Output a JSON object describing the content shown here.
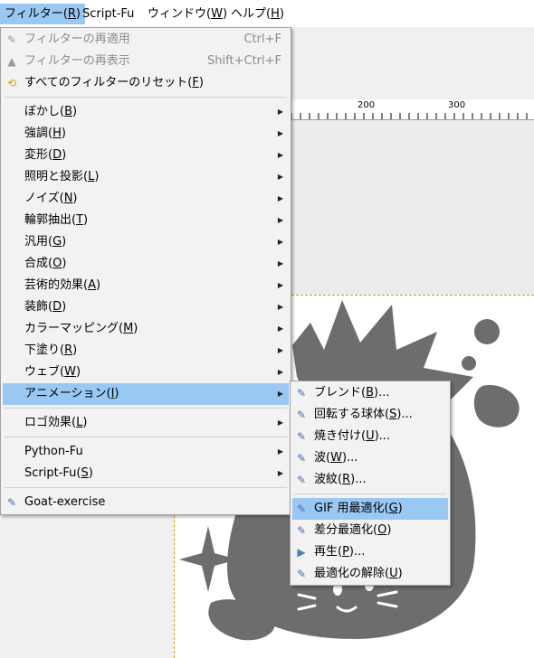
{
  "menubar": {
    "filters": {
      "label": "フィルター(",
      "mn": "R",
      "tail": ")"
    },
    "script_fu": {
      "label": "Script-Fu"
    },
    "windows": {
      "label": "ウィンドウ(",
      "mn": "W",
      "tail": ")"
    },
    "help": {
      "label": "ヘルプ(",
      "mn": "H",
      "tail": ")"
    }
  },
  "ruler": {
    "label_200": "200",
    "label_300": "300"
  },
  "filters_menu": {
    "reapply": {
      "label": "フィルターの再適用",
      "shortcut": "Ctrl+F"
    },
    "reshow": {
      "label": "フィルターの再表示",
      "shortcut": "Shift+Ctrl+F"
    },
    "reset_all": {
      "label": "すべてのフィルターのリセット(",
      "mn": "F",
      "tail": ")"
    },
    "blur": {
      "label": "ぼかし(",
      "mn": "B",
      "tail": ")"
    },
    "enhance": {
      "label": "強調(",
      "mn": "H",
      "tail": ")"
    },
    "distorts": {
      "label": "変形(",
      "mn": "D",
      "tail": ")"
    },
    "light_shadow": {
      "label": "照明と投影(",
      "mn": "L",
      "tail": ")"
    },
    "noise": {
      "label": "ノイズ(",
      "mn": "N",
      "tail": ")"
    },
    "edge_detect": {
      "label": "輪郭抽出(",
      "mn": "T",
      "tail": ")"
    },
    "generic": {
      "label": "汎用(",
      "mn": "G",
      "tail": ")"
    },
    "combine": {
      "label": "合成(",
      "mn": "O",
      "tail": ")"
    },
    "artistic": {
      "label": "芸術的効果(",
      "mn": "A",
      "tail": ")"
    },
    "decor": {
      "label": "装飾(",
      "mn": "D",
      "tail": ")"
    },
    "map": {
      "label": "カラーマッピング(",
      "mn": "M",
      "tail": ")"
    },
    "render": {
      "label": "下塗り(",
      "mn": "R",
      "tail": ")"
    },
    "web": {
      "label": "ウェブ(",
      "mn": "W",
      "tail": ")"
    },
    "animation": {
      "label": "アニメーション(",
      "mn": "I",
      "tail": ")"
    },
    "alpha_to_logo": {
      "label": "ロゴ効果(",
      "mn": "L",
      "tail": ")"
    },
    "python_fu": {
      "label": "Python-Fu"
    },
    "script_fu": {
      "label": "Script-Fu(",
      "mn": "S",
      "tail": ")"
    },
    "goat_exercise": {
      "label": "Goat-exercise"
    }
  },
  "animation_menu": {
    "blend": {
      "label": "ブレンド(",
      "mn": "B",
      "tail": ")..."
    },
    "spinning_globe": {
      "label": "回転する球体(",
      "mn": "S",
      "tail": ")..."
    },
    "burn_in": {
      "label": "焼き付け(",
      "mn": "U",
      "tail": ")..."
    },
    "waves": {
      "label": "波(",
      "mn": "W",
      "tail": ")..."
    },
    "rippling": {
      "label": "波紋(",
      "mn": "R",
      "tail": ")..."
    },
    "optimize_gif": {
      "label": "GIF 用最適化(",
      "mn": "G",
      "tail": ")"
    },
    "optimize_diff": {
      "label": "差分最適化(",
      "mn": "O",
      "tail": ")"
    },
    "playback": {
      "label": "再生(",
      "mn": "P",
      "tail": ")..."
    },
    "unoptimize": {
      "label": "最適化の解除(",
      "mn": "U",
      "tail": ")"
    }
  },
  "icons": {
    "plugin": "plugin-icon",
    "reshow": "reshow-icon",
    "reset": "reset-icon",
    "submenu": "chevron-right-icon",
    "playback": "play-icon"
  },
  "colors": {
    "highlight": "#99c9f3",
    "disabled": "#8c8c8c",
    "image_ink": "#6d6d6d"
  }
}
